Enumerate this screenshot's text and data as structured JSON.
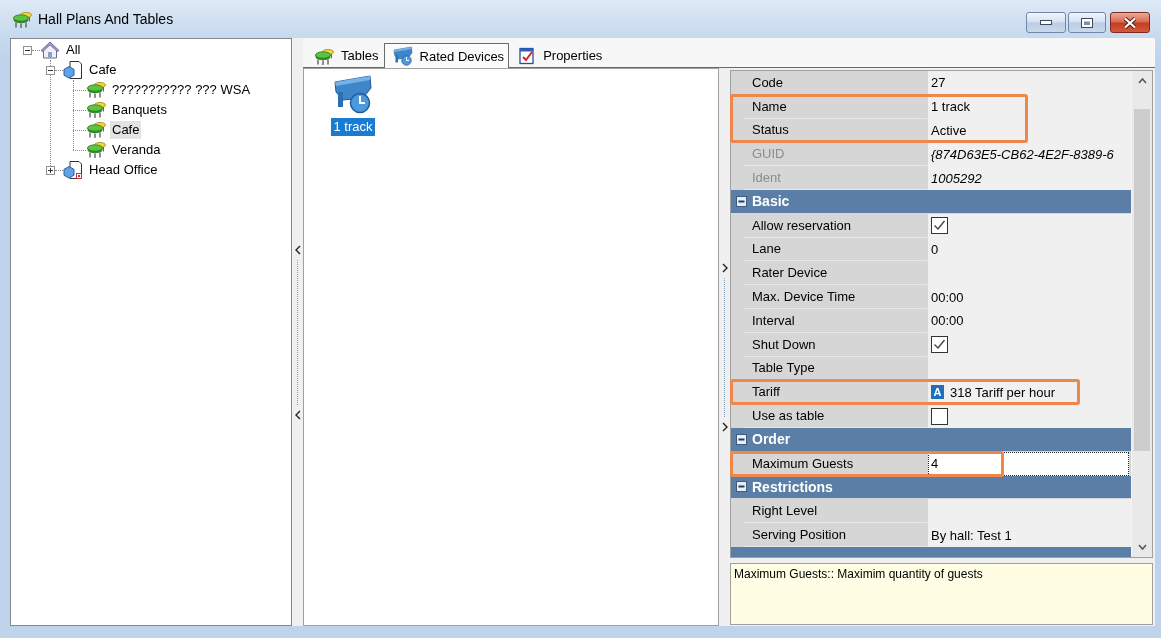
{
  "window": {
    "title": "Hall Plans And Tables"
  },
  "tree": {
    "nodes": [
      {
        "label": "All",
        "kind": "root",
        "expanded": true,
        "selected": false,
        "children": [
          {
            "label": "Cafe",
            "kind": "group",
            "expanded": true,
            "selected": false,
            "children": [
              {
                "label": "??????????? ??? WSA",
                "kind": "hall",
                "selected": false
              },
              {
                "label": "Banquets",
                "kind": "hall",
                "selected": false
              },
              {
                "label": "Cafe",
                "kind": "hall",
                "selected": true
              },
              {
                "label": "Veranda",
                "kind": "hall",
                "selected": false
              }
            ]
          },
          {
            "label": "Head Office",
            "kind": "office",
            "expanded": false,
            "selected": false
          }
        ]
      }
    ]
  },
  "tabs": [
    {
      "label": "Tables",
      "kind": "tables",
      "selected": false
    },
    {
      "label": "Rated Devices",
      "kind": "devices",
      "selected": true
    },
    {
      "label": "Properties",
      "kind": "properties",
      "selected": false
    }
  ],
  "devices": [
    {
      "label": "1 track",
      "selected": true
    }
  ],
  "properties": {
    "rows": [
      {
        "kind": "text",
        "label": "Code",
        "value": "27",
        "disabled": false,
        "selected": false,
        "highlighted": false
      },
      {
        "kind": "text",
        "label": "Name",
        "value": "1 track",
        "disabled": false,
        "selected": false,
        "highlighted": true
      },
      {
        "kind": "text",
        "label": "Status",
        "value": "Active",
        "disabled": false,
        "selected": false,
        "highlighted": true
      },
      {
        "kind": "text",
        "label": "GUID",
        "value": "{874D63E5-CB62-4E2F-8389-6",
        "disabled": true,
        "selected": false,
        "highlighted": false
      },
      {
        "kind": "text",
        "label": "Ident",
        "value": "1005292",
        "disabled": true,
        "selected": false,
        "highlighted": false
      },
      {
        "kind": "category",
        "label": "Basic",
        "expanded": true
      },
      {
        "kind": "checkbox",
        "label": "Allow reservation",
        "checked": true,
        "disabled": false,
        "selected": false,
        "highlighted": false
      },
      {
        "kind": "text",
        "label": "Lane",
        "value": "0",
        "disabled": false,
        "selected": false,
        "highlighted": false
      },
      {
        "kind": "text",
        "label": "Rater Device",
        "disabled": false,
        "selected": false,
        "highlighted": false
      },
      {
        "kind": "text",
        "label": "Max. Device Time",
        "value": "00:00",
        "disabled": false,
        "selected": false,
        "highlighted": false
      },
      {
        "kind": "text",
        "label": "Interval",
        "value": "00:00",
        "disabled": false,
        "selected": false,
        "highlighted": false
      },
      {
        "kind": "checkbox",
        "label": "Shut Down",
        "checked": true,
        "disabled": false,
        "selected": false,
        "highlighted": false
      },
      {
        "kind": "text",
        "label": "Table Type",
        "disabled": false,
        "selected": false,
        "highlighted": false
      },
      {
        "kind": "text",
        "label": "Tariff",
        "badge": "A",
        "value": "318 Tariff per hour",
        "disabled": false,
        "selected": false,
        "highlighted": true
      },
      {
        "kind": "checkbox",
        "label": "Use as table",
        "checked": false,
        "disabled": false,
        "selected": false,
        "highlighted": false
      },
      {
        "kind": "category",
        "label": "Order",
        "expanded": true
      },
      {
        "kind": "text",
        "label": "Maximum Guests",
        "value": "4",
        "disabled": false,
        "selected": true,
        "highlighted": true
      },
      {
        "kind": "category",
        "label": "Restrictions",
        "expanded": true
      },
      {
        "kind": "text",
        "label": "Right Level",
        "disabled": false,
        "selected": false,
        "highlighted": false
      },
      {
        "kind": "text",
        "label": "Serving Position",
        "value": "By hall: Test 1",
        "disabled": false,
        "selected": false,
        "highlighted": false
      },
      {
        "kind": "category"
      }
    ],
    "description": "Maximum Guests:: Maximim quantity of guests"
  }
}
